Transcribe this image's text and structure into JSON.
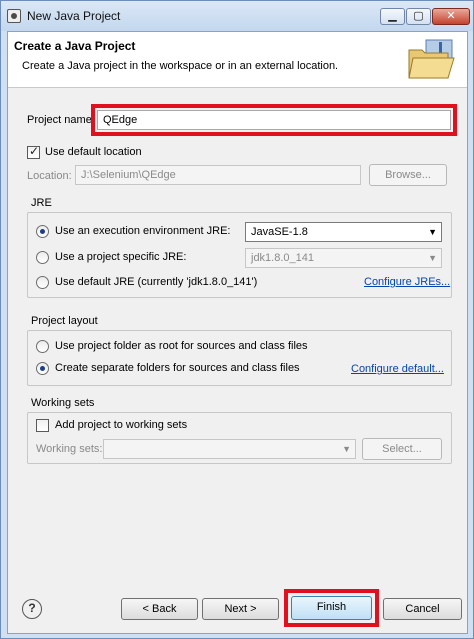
{
  "window": {
    "title": "New Java Project",
    "min_glyph": "▁",
    "max_glyph": "▢",
    "close_glyph": "✕"
  },
  "banner": {
    "title": "Create a Java Project",
    "description": "Create a Java project in the workspace or in an external location."
  },
  "project": {
    "name_label": "Project name:",
    "name_value": "QEdge",
    "use_default_location_label": "Use default location",
    "use_default_location_checked": true,
    "location_label": "Location:",
    "location_value": "J:\\Selenium\\QEdge",
    "browse_label": "Browse..."
  },
  "jre": {
    "group_title": "JRE",
    "option_env_label": "Use an execution environment JRE:",
    "option_env_value": "JavaSE-1.8",
    "option_specific_label": "Use a project specific JRE:",
    "option_specific_value": "jdk1.8.0_141",
    "option_default_label": "Use default JRE (currently 'jdk1.8.0_141')",
    "configure_link": "Configure JREs...",
    "selected": "env"
  },
  "layout": {
    "group_title": "Project layout",
    "option_root_label": "Use project folder as root for sources and class files",
    "option_separate_label": "Create separate folders for sources and class files",
    "configure_link": "Configure default...",
    "selected": "separate"
  },
  "working_sets": {
    "group_title": "Working sets",
    "add_label": "Add project to working sets",
    "add_checked": false,
    "sets_label": "Working sets:",
    "sets_value": "",
    "select_label": "Select..."
  },
  "footer": {
    "help_glyph": "?",
    "back_label": "< Back",
    "next_label": "Next >",
    "finish_label": "Finish",
    "cancel_label": "Cancel"
  },
  "colors": {
    "highlight": "#e0101e",
    "link": "#0645ad"
  }
}
